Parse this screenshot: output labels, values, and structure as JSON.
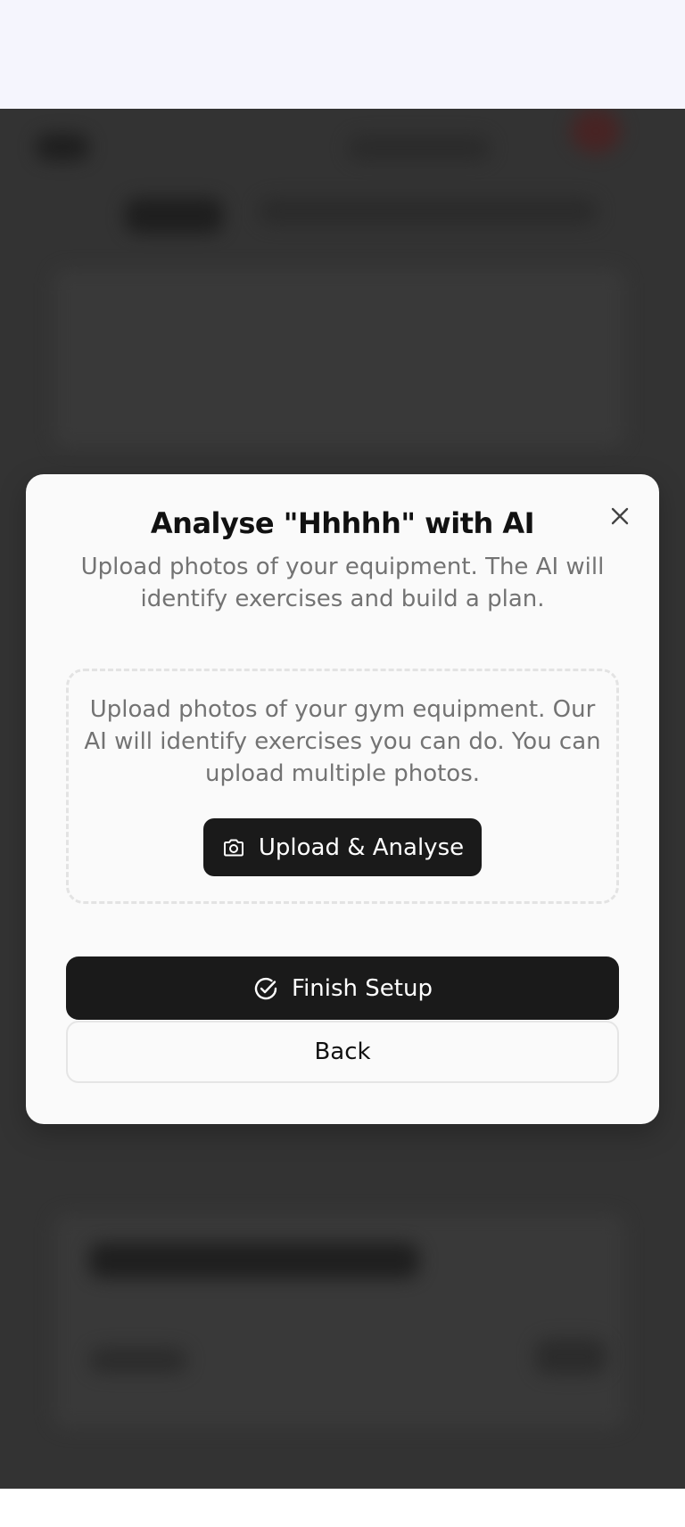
{
  "modal": {
    "title": "Analyse \"Hhhhh\" with AI",
    "subtitle": "Upload photos of your equipment. The AI will identify exercises and build a plan.",
    "upload_description": "Upload photos of your gym equipment. Our AI will identify exercises you can do. You can upload multiple photos.",
    "upload_button_label": "Upload & Analyse",
    "finish_button_label": "Finish Setup",
    "back_button_label": "Back",
    "icons": {
      "close": "close-icon",
      "upload": "camera-icon",
      "finish": "check-circle-icon"
    }
  },
  "colors": {
    "overlay": "#333333",
    "modal_bg": "#fafafa",
    "primary_button": "#1a1a1a",
    "top_band": "#f5f5fd"
  }
}
